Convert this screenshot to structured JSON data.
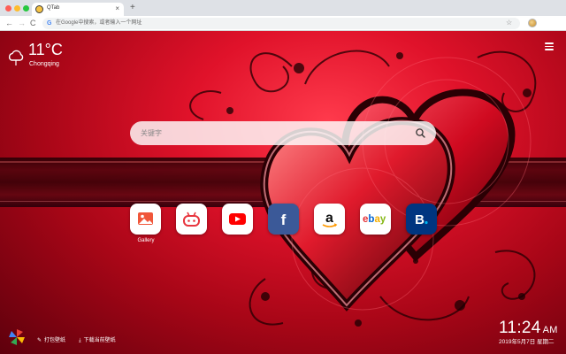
{
  "browser": {
    "tab_title": "QTab",
    "tab_close": "×",
    "new_tab": "+",
    "address_placeholder": "在Google中搜索，或者输入一个网址",
    "back": "←",
    "forward": "→",
    "reload": "C",
    "star": "☆",
    "menu": "⋮"
  },
  "weather": {
    "temperature": "11°C",
    "city": "Chongqing"
  },
  "search": {
    "placeholder": "关键字"
  },
  "shortcuts": [
    {
      "label": "Gallery",
      "icon": "gallery-icon",
      "color": "#f0563a"
    },
    {
      "label": "",
      "icon": "gamepad-icon",
      "color": "#e8363f"
    },
    {
      "label": "",
      "icon": "youtube-icon",
      "color": "#ff0000"
    },
    {
      "label": "",
      "icon": "facebook-icon",
      "color": "#3b5998"
    },
    {
      "label": "",
      "icon": "amazon-icon",
      "color": "#ff9900"
    },
    {
      "label": "",
      "icon": "ebay-icon",
      "color": "#e53238"
    },
    {
      "label": "",
      "icon": "booking-icon",
      "color": "#003580"
    }
  ],
  "bottom": {
    "wallpaper_link": "打包壁纸",
    "download_link": "下载当前壁纸",
    "time": "11:24",
    "ampm": "AM",
    "date": "2019年5月7日 星期二"
  },
  "colors": {
    "wallpaper_red": "#e0122a",
    "wallpaper_dark": "#5e000c"
  }
}
